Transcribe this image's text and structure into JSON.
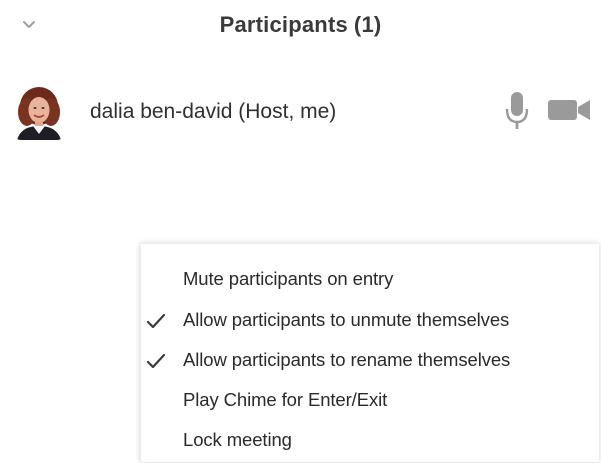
{
  "header": {
    "title": "Participants",
    "count": "(1)",
    "collapse_icon": "chevron-down-icon"
  },
  "participants": [
    {
      "name": "dalia ben-david (Host, me)",
      "avatar": "user-photo-avatar",
      "mic_icon": "microphone-icon",
      "mic_state": "unmuted",
      "video_icon": "video-camera-icon",
      "video_state": "on"
    }
  ],
  "more_menu": {
    "items": [
      {
        "label": "Mute participants on entry",
        "checked": false
      },
      {
        "label": "Allow participants to unmute themselves",
        "checked": true
      },
      {
        "label": "Allow participants to rename themselves",
        "checked": true
      },
      {
        "label": "Play Chime for Enter/Exit",
        "checked": false
      },
      {
        "label": "Lock meeting",
        "checked": false
      }
    ]
  },
  "colors": {
    "text": "#2f2f2f",
    "icon_gray": "#9a9a9a",
    "menu_bg": "#ffffff"
  }
}
